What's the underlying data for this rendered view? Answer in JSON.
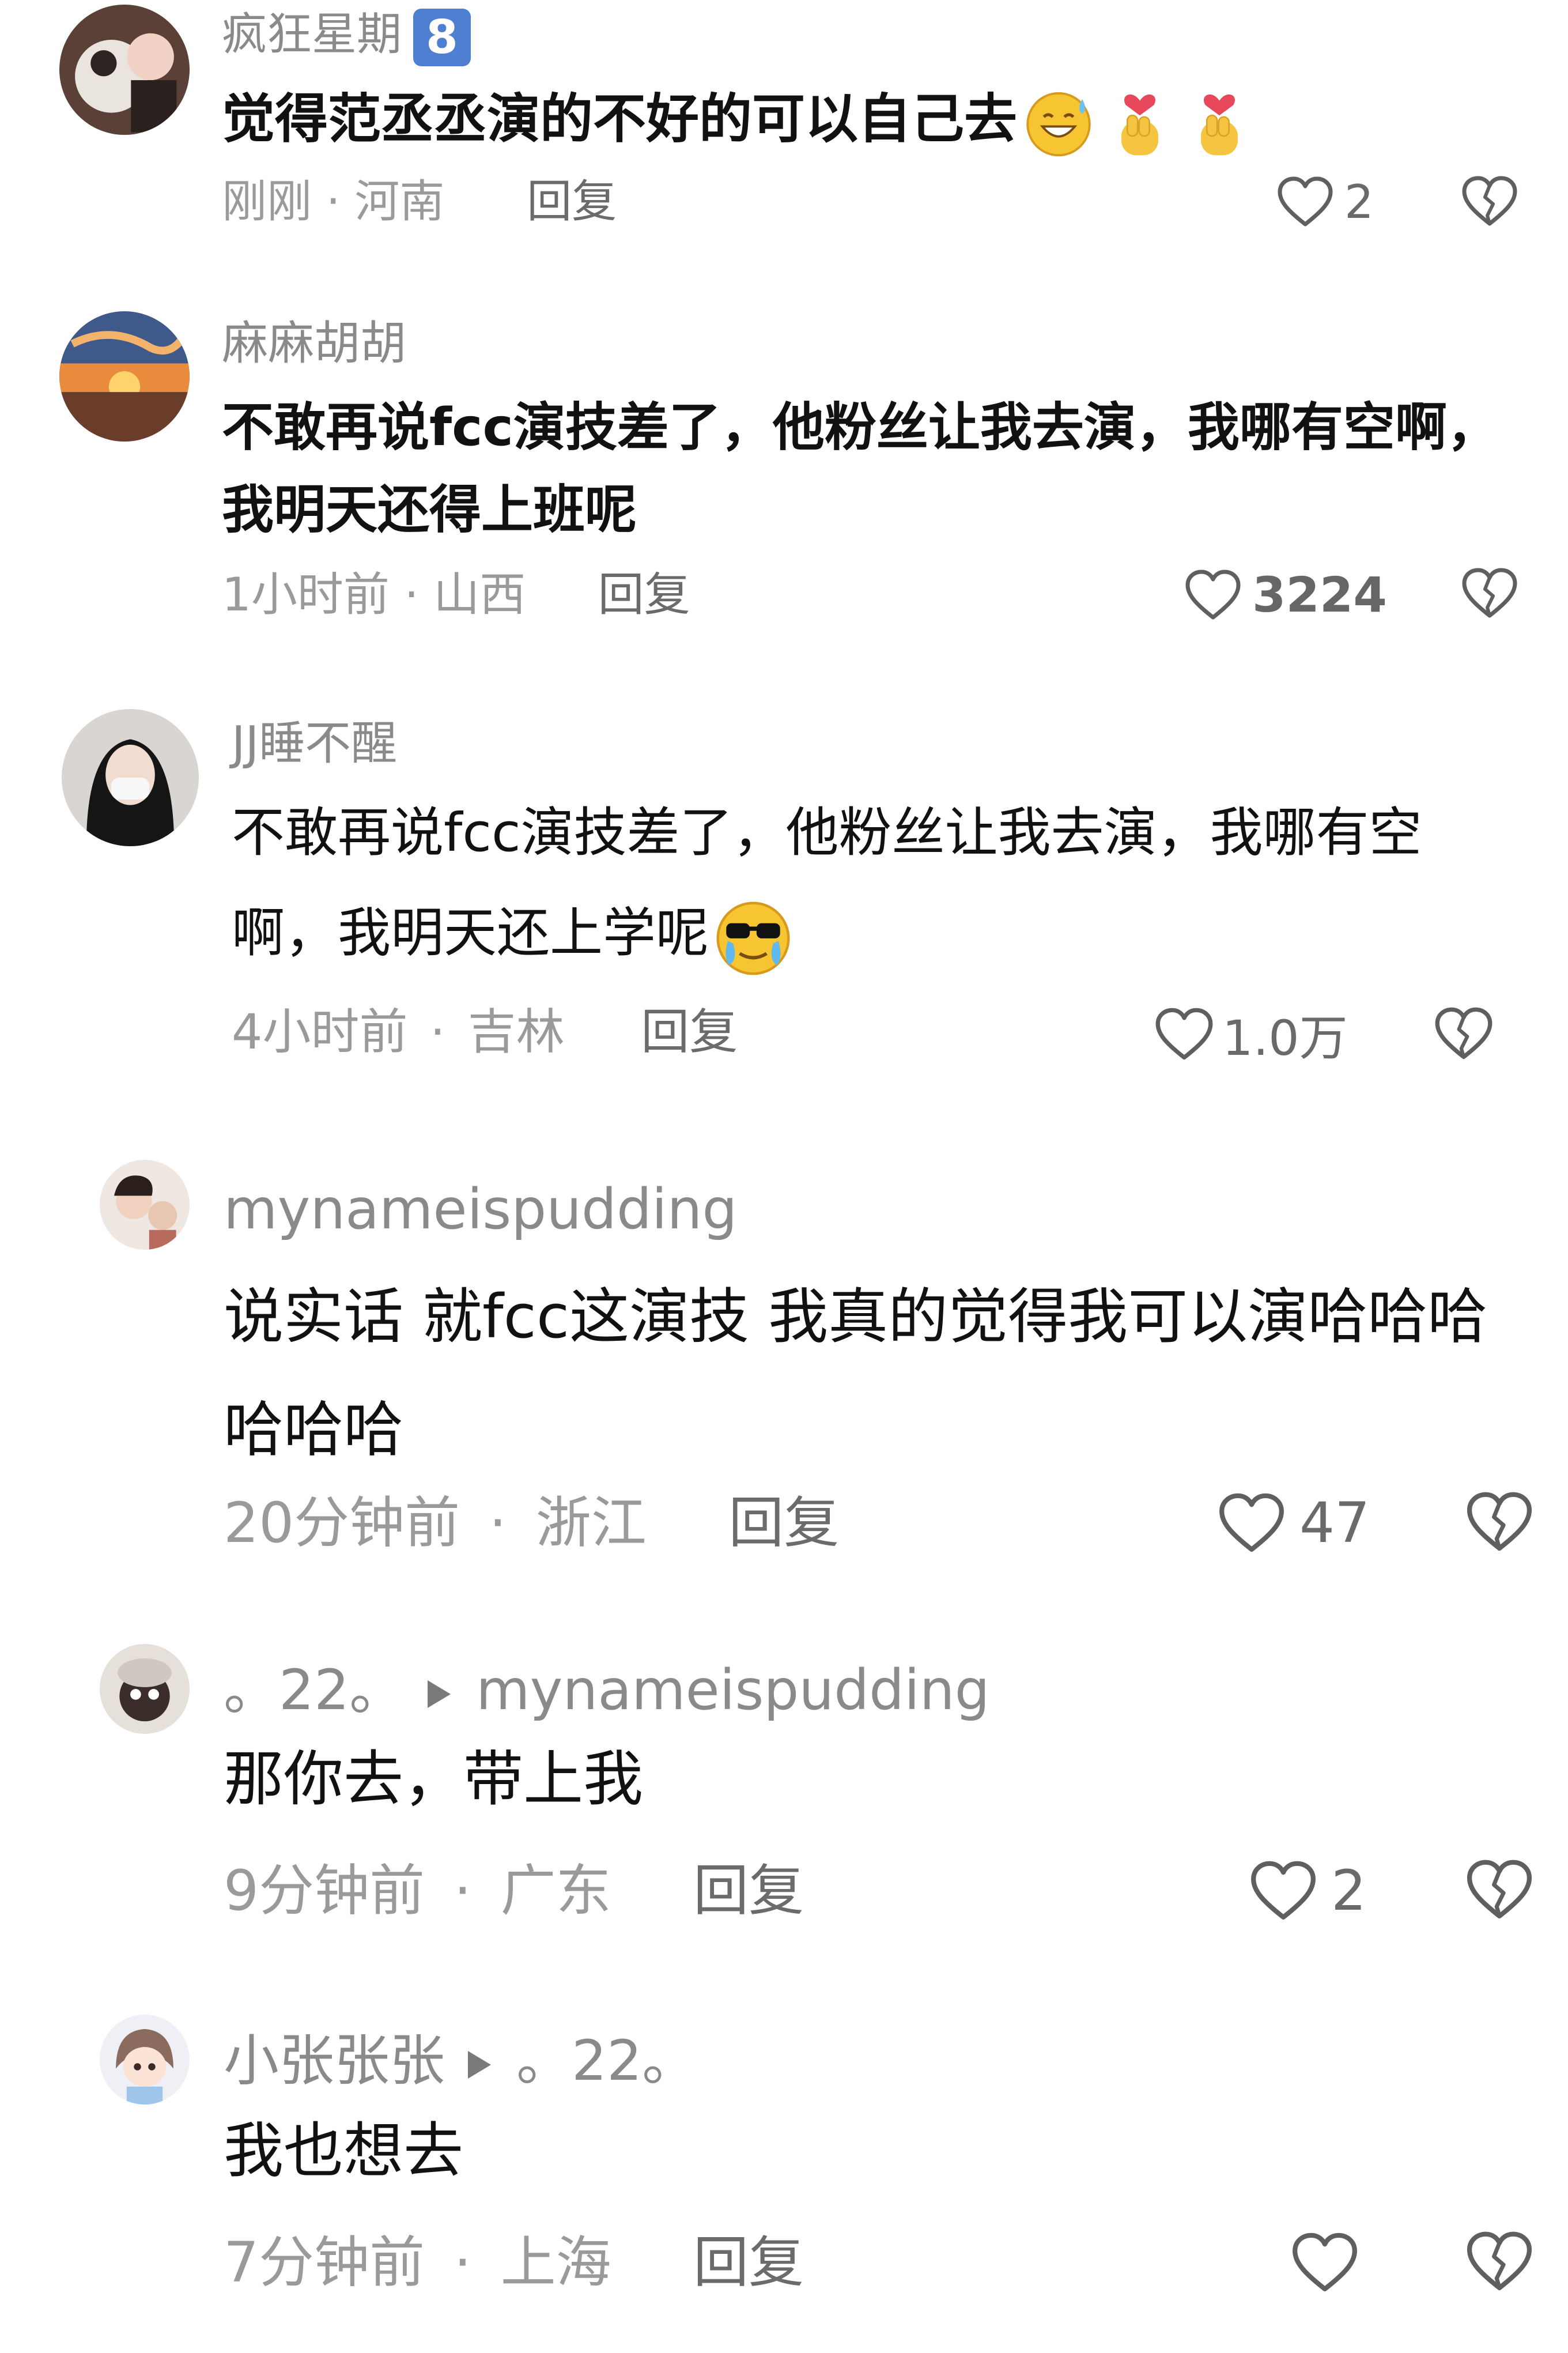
{
  "comments": [
    {
      "username": "疯狂星期",
      "badge": "8",
      "text": "觉得范丞丞演的不好的可以自己去",
      "emojis": [
        "sweat-smile-emoji",
        "finger-heart-emoji",
        "finger-heart-emoji"
      ],
      "time": "刚刚",
      "location": "河南",
      "reply_label": "回复",
      "likes": "2"
    },
    {
      "username": "麻麻胡胡",
      "text": "不敢再说fcc演技差了，他粉丝让我去演，我哪有空啊，我明天还得上班呢",
      "time": "1小时前",
      "location": "山西",
      "reply_label": "回复",
      "likes": "3224"
    },
    {
      "username": "JJ睡不醒",
      "text": "不敢再说fcc演技差了，他粉丝让我去演，我哪有空啊，我明天还上学呢",
      "emojis": [
        "cool-cry-emoji"
      ],
      "time": "4小时前",
      "location": "吉林",
      "reply_label": "回复",
      "likes": "1.0万"
    },
    {
      "username": "mynameispudding",
      "text": "说实话 就fcc这演技 我真的觉得我可以演哈哈哈哈哈哈",
      "time": "20分钟前",
      "location": "浙江",
      "reply_label": "回复",
      "likes": "47"
    },
    {
      "username": "。22。",
      "reply_to": "mynameispudding",
      "text": "那你去，带上我",
      "time": "9分钟前",
      "location": "广东",
      "reply_label": "回复",
      "likes": "2"
    },
    {
      "username": "小张张张",
      "reply_to": "。22。",
      "text": "我也想去",
      "time": "7分钟前",
      "location": "上海",
      "reply_label": "回复",
      "likes": ""
    }
  ],
  "meta_separator": "·",
  "colors": {
    "text": "#111111",
    "muted": "#8a8a8a",
    "badge": "#4f7fd1"
  }
}
